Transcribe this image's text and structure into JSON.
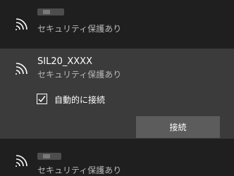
{
  "networks": [
    {
      "ssid": "",
      "status": "セキュリティ保護あり",
      "redacted": true
    },
    {
      "ssid": "SIL20_XXXX",
      "status": "セキュリティ保護あり",
      "selected": true,
      "auto_connect_label": "自動的に接続",
      "auto_connect_checked": true,
      "connect_label": "接続"
    },
    {
      "ssid": "",
      "status": "セキュリティ保護あり",
      "redacted": true
    }
  ],
  "colors": {
    "background": "#1f1f1f",
    "selected_background": "#3b3b3b",
    "button": "#5c5c5c",
    "secondary_text": "#b9b9b9"
  },
  "icons": [
    "wifi-icon",
    "checkmark-icon"
  ]
}
